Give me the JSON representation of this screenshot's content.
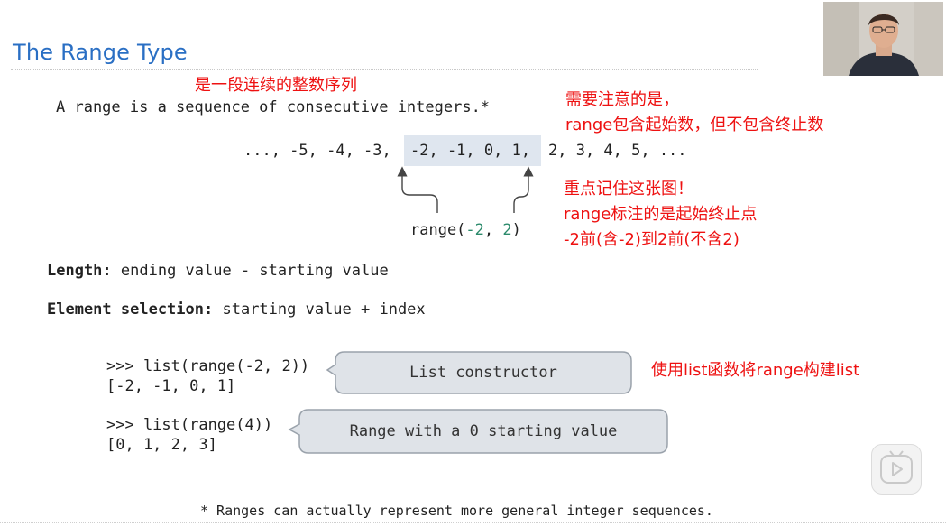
{
  "slide": {
    "title": "The Range Type",
    "intro_note": "是一段连续的整数序列",
    "definition": "A range is a sequence of consecutive integers.*",
    "sequence": {
      "prefix": "..., -5, -4, -3,",
      "highlighted": "-2, -1, 0, 1,",
      "suffix": "2, 3, 4, 5, ..."
    },
    "range_label": {
      "fn": "range(",
      "start": "-2",
      "sep": ", ",
      "stop": "2",
      "close": ")"
    },
    "notes_right": {
      "line1": "需要注意的是，",
      "line2": "range包含起始数，但不包含终止数",
      "line3": "重点记住这张图！",
      "line4": "range标注的是起始终止点",
      "line5": "-2前(含-2)到2前(不含2)"
    },
    "length": {
      "label": "Length:",
      "text": "ending value - starting value"
    },
    "element_selection": {
      "label": "Element selection:",
      "text": "starting value + index"
    },
    "example1": {
      "prompt": ">>> list(range(-2, 2))",
      "output": "[-2, -1, 0, 1]",
      "bubble": "List constructor",
      "note": "使用list函数将range构建list"
    },
    "example2": {
      "prompt": ">>> list(range(4))",
      "output": "[0, 1, 2, 3]",
      "bubble": "Range with a 0 starting value"
    },
    "footnote": "* Ranges can actually represent more general integer sequences."
  },
  "colors": {
    "title": "#2a6fc4",
    "note_red": "#ee1111",
    "teal": "#2b8a6b",
    "highlight": "#dfe6ef",
    "bubble_fill": "#dfe3e8"
  },
  "icons": {
    "play": "play-icon"
  }
}
